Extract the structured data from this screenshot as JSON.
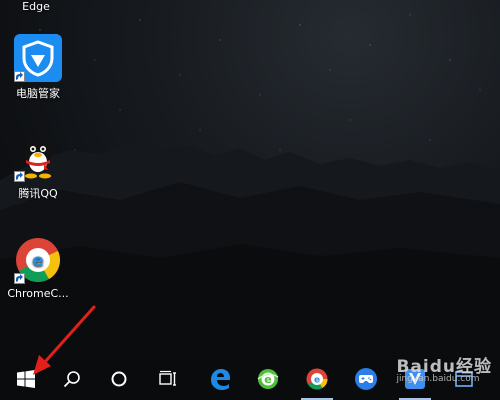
{
  "desktop": {
    "top_label": "Edge",
    "icons": [
      {
        "label": "电脑管家",
        "icon": "tencent-pc-manager-icon"
      },
      {
        "label": "腾讯QQ",
        "icon": "qq-penguin-icon"
      },
      {
        "label": "ChromeC...",
        "icon": "chrome-core-browser-icon"
      }
    ]
  },
  "taskbar": {
    "items": [
      {
        "name": "start",
        "icon": "windows-logo-icon"
      },
      {
        "name": "search",
        "icon": "search-icon"
      },
      {
        "name": "cortana",
        "icon": "cortana-circle-icon"
      },
      {
        "name": "task-view",
        "icon": "task-view-icon"
      },
      {
        "name": "edge",
        "icon": "edge-browser-icon"
      },
      {
        "name": "green-browser",
        "icon": "360-browser-icon"
      },
      {
        "name": "chrome",
        "icon": "chrome-browser-icon"
      },
      {
        "name": "game",
        "icon": "game-controller-icon"
      },
      {
        "name": "security",
        "icon": "shield-v-icon"
      }
    ]
  },
  "watermark": {
    "main": "Baidu经验",
    "sub": "jingyan.baidu.com"
  },
  "colors": {
    "arrow": "#e0201a",
    "taskbar": "#0a0b0d",
    "accent_underline": "#a7c4e6"
  }
}
